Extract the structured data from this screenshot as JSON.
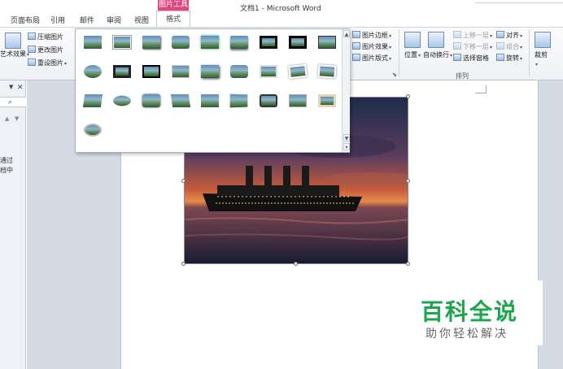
{
  "window": {
    "title": "文档1 - Microsoft Word"
  },
  "tabs": [
    {
      "label": "页面布局"
    },
    {
      "label": "引用"
    },
    {
      "label": "邮件"
    },
    {
      "label": "审阅"
    },
    {
      "label": "视图"
    }
  ],
  "context_tab": {
    "group_label": "图片工具",
    "label": "格式"
  },
  "ribbon": {
    "adjust": {
      "art_effects": "艺术效果",
      "compress": "压缩图片",
      "change": "更改图片",
      "reset": "重设图片"
    },
    "picture_styles": {
      "border": "图片边框",
      "effects": "图片效果",
      "layout": "图片版式"
    },
    "arrange": {
      "position": "位置",
      "wrap": "自动换行",
      "forward": "上移一层",
      "backward": "下移一层",
      "selection_pane": "选择窗格",
      "align": "对齐",
      "group": "组合",
      "rotate": "旋转",
      "group_label": "排列"
    },
    "size": {
      "crop": "裁剪"
    }
  },
  "nav_pane": {
    "text": "通过\n档中"
  },
  "logo": {
    "title": "百科全说",
    "subtitle": "助你轻松解决"
  },
  "colors": {
    "context_tab": "#e0467d",
    "ribbon_bg": "#eef1f5",
    "doc_bg": "#d4dbe4",
    "logo_green": "#1aa64b"
  },
  "icons": {
    "nav_close": "close-icon",
    "nav_search": "search-icon",
    "gallery_scroll_up": "chevron-up-icon",
    "gallery_scroll_down": "chevron-down-icon",
    "gallery_more": "more-icon"
  }
}
